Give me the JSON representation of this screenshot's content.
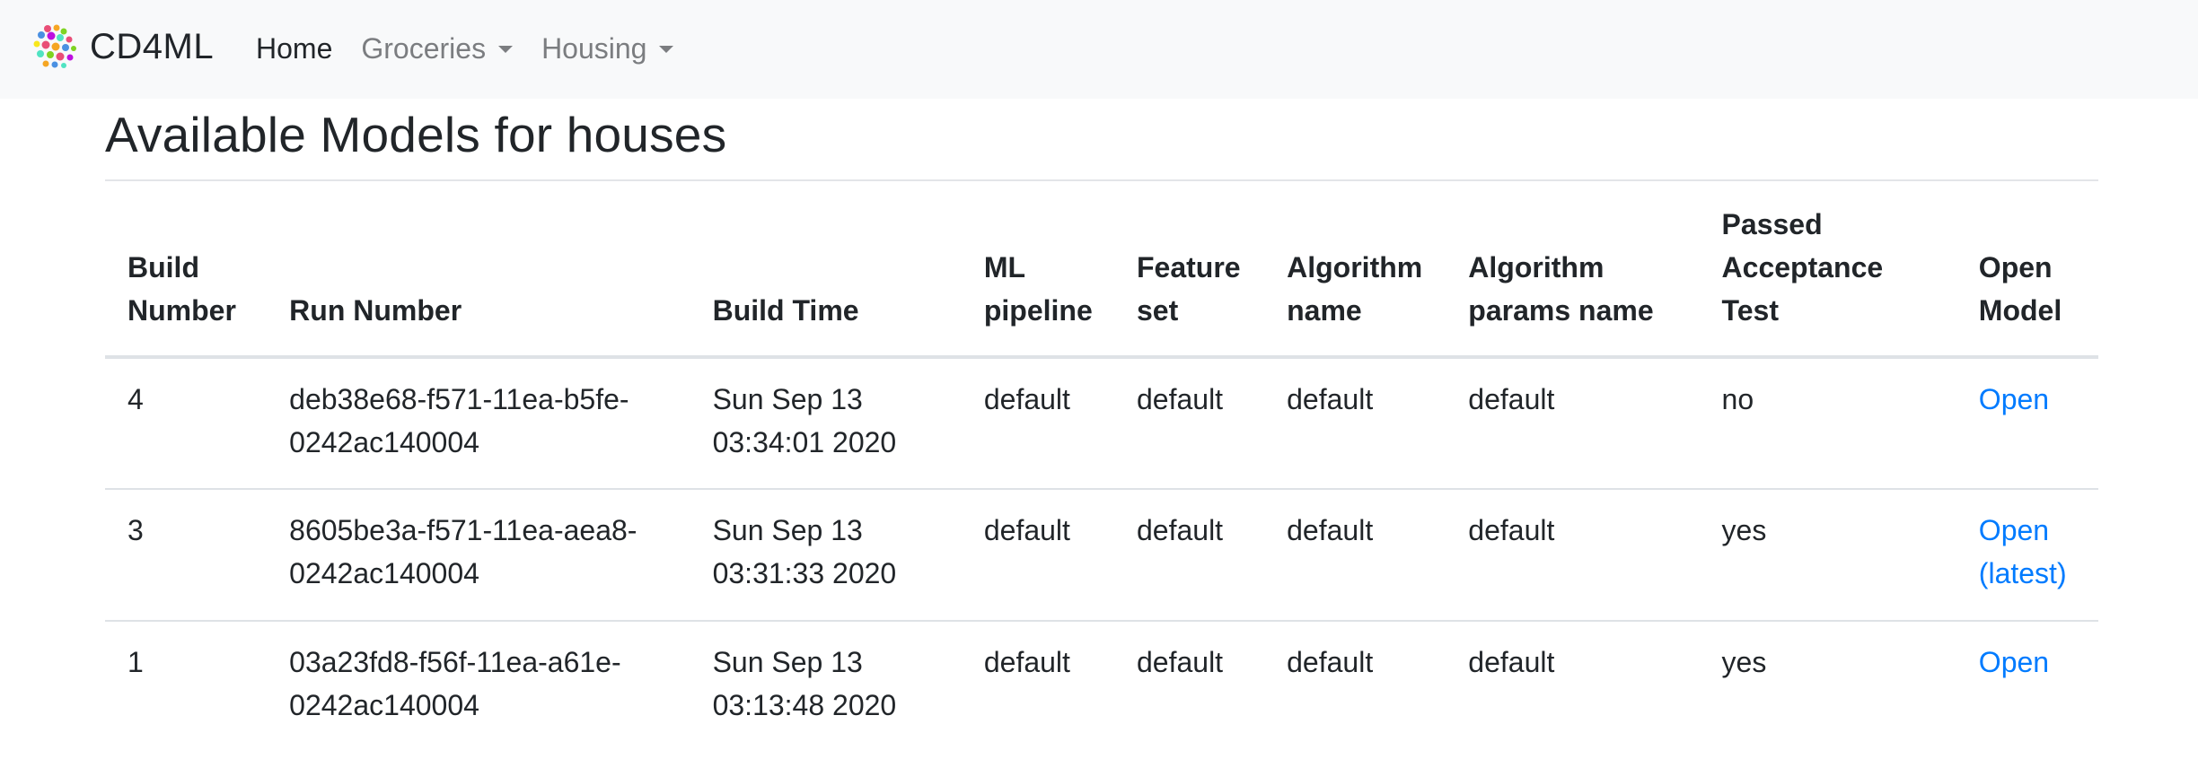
{
  "navbar": {
    "brand": "CD4ML",
    "items": [
      {
        "label": "Home",
        "active": true,
        "dropdown": false
      },
      {
        "label": "Groceries",
        "active": false,
        "dropdown": true
      },
      {
        "label": "Housing",
        "active": false,
        "dropdown": true
      }
    ]
  },
  "page": {
    "title": "Available Models for houses"
  },
  "table": {
    "headers": [
      [
        "Build",
        "Number"
      ],
      [
        "Run Number"
      ],
      [
        "Build Time"
      ],
      [
        "ML",
        "pipeline"
      ],
      [
        "Feature",
        "set"
      ],
      [
        "Algorithm",
        "name"
      ],
      [
        "Algorithm",
        "params name"
      ],
      [
        "Passed",
        "Acceptance",
        "Test"
      ],
      [
        "Open",
        "Model"
      ]
    ],
    "rows": [
      {
        "build_number": "4",
        "run_number": [
          "deb38e68-f571-11ea-b5fe-",
          "0242ac140004"
        ],
        "build_time": [
          "Sun Sep 13",
          "03:34:01 2020"
        ],
        "ml_pipeline": "default",
        "feature_set": "default",
        "algorithm_name": "default",
        "algorithm_params_name": "default",
        "passed_acceptance_test": "no",
        "open_model": [
          "Open"
        ]
      },
      {
        "build_number": "3",
        "run_number": [
          "8605be3a-f571-11ea-aea8-",
          "0242ac140004"
        ],
        "build_time": [
          "Sun Sep 13",
          "03:31:33 2020"
        ],
        "ml_pipeline": "default",
        "feature_set": "default",
        "algorithm_name": "default",
        "algorithm_params_name": "default",
        "passed_acceptance_test": "yes",
        "open_model": [
          "Open",
          "(latest)"
        ]
      },
      {
        "build_number": "1",
        "run_number": [
          "03a23fd8-f56f-11ea-a61e-",
          "0242ac140004"
        ],
        "build_time": [
          "Sun Sep 13",
          "03:13:48 2020"
        ],
        "ml_pipeline": "default",
        "feature_set": "default",
        "algorithm_name": "default",
        "algorithm_params_name": "default",
        "passed_acceptance_test": "yes",
        "open_model": [
          "Open"
        ]
      }
    ]
  },
  "colors": {
    "navbar_bg": "#f8f9fa",
    "link": "#007bff",
    "nav_inactive": "#7b7d80",
    "text": "#212529",
    "border": "#dee2e6"
  },
  "icons": {
    "brand": "cd4ml-logo-icon",
    "dropdown": "caret-down-icon"
  }
}
